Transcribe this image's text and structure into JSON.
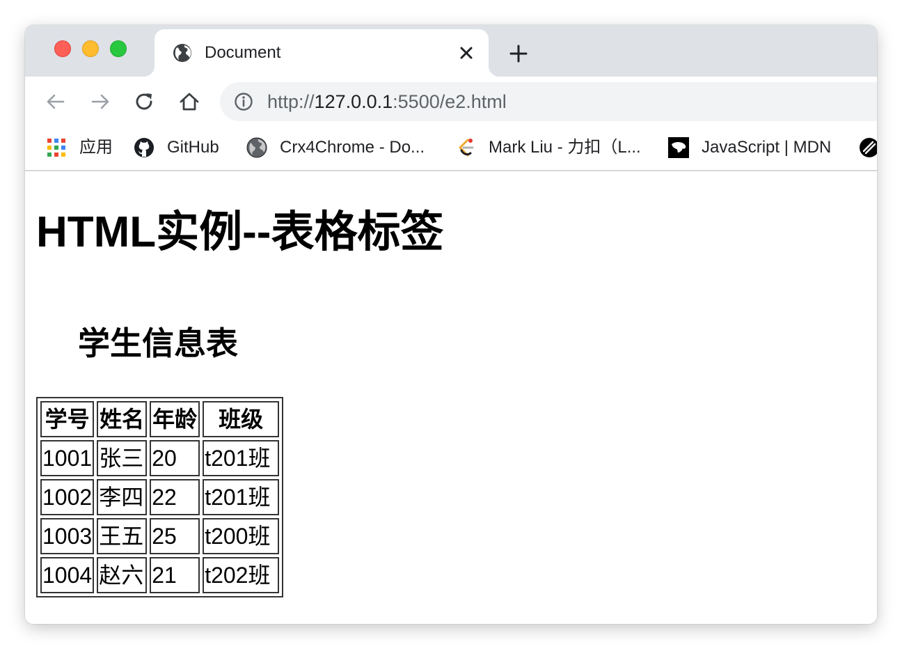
{
  "browser": {
    "tab": {
      "title": "Document",
      "favicon": "globe-icon"
    },
    "new_tab_icon": "plus-icon",
    "toolbar": {
      "back_icon": "arrow-left-icon",
      "forward_icon": "arrow-right-icon",
      "reload_icon": "reload-icon",
      "home_icon": "home-icon",
      "url_prefix": "http://",
      "url_host": "127.0.0.1",
      "url_rest": ":5500/e2.html"
    },
    "bookmarks": [
      {
        "label": "应用",
        "icon": "apps-grid-icon"
      },
      {
        "label": "GitHub",
        "icon": "github-icon"
      },
      {
        "label": "Crx4Chrome - Do...",
        "icon": "crx4chrome-icon"
      },
      {
        "label": "Mark Liu - 力扣（L...",
        "icon": "leetcode-icon"
      },
      {
        "label": "JavaScript | MDN",
        "icon": "mdn-icon"
      }
    ]
  },
  "page": {
    "heading": "HTML实例--表格标签",
    "table": {
      "caption": "学生信息表",
      "headers": [
        "学号",
        "姓名",
        "年龄",
        "班级"
      ],
      "rows": [
        [
          "1001",
          "张三",
          "20",
          "t201班"
        ],
        [
          "1002",
          "李四",
          "22",
          "t201班"
        ],
        [
          "1003",
          "王五",
          "25",
          "t200班"
        ],
        [
          "1004",
          "赵六",
          "21",
          "t202班"
        ]
      ]
    }
  },
  "colors": {
    "tabstrip": "#dee1e6",
    "omnibox": "#f1f3f4",
    "traffic_red": "#fe5f57",
    "traffic_yellow": "#febc2e",
    "traffic_green": "#28c840"
  }
}
